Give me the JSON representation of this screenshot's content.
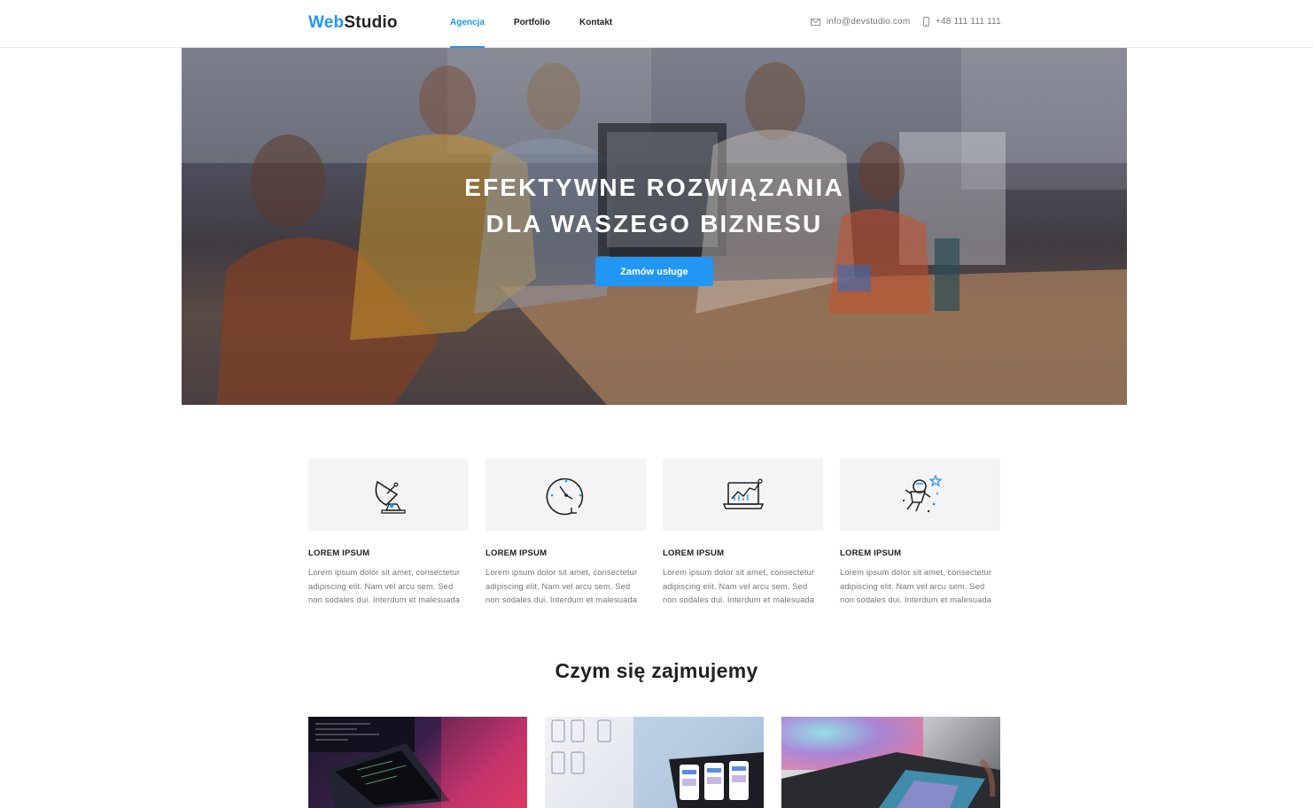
{
  "header": {
    "logo_web": "Web",
    "logo_studio": "Studio",
    "nav": [
      {
        "label": "Agencja",
        "active": true
      },
      {
        "label": "Portfolio",
        "active": false
      },
      {
        "label": "Kontakt",
        "active": false
      }
    ],
    "email": "info@devstudio.com",
    "phone": "+48 111 111 111",
    "email_icon": "envelope-icon",
    "phone_icon": "mobile-phone-icon"
  },
  "hero": {
    "title_line1": "EFEKTYWNE ROZWIĄZANIA",
    "title_line2": "DLA WASZEGO BIZNESU",
    "button_label": "Zamów usługe"
  },
  "features": [
    {
      "icon": "satellite-dish-icon",
      "title": "LOREM IPSUM",
      "line1": "Lorem ipsum dolor sit amet, consectetur",
      "line2": "adipiscing elit. Nam vel arcu sem. Sed",
      "line3": "non sodales dui. Interdum et malesuada"
    },
    {
      "icon": "clock-icon",
      "title": "LOREM IPSUM",
      "line1": "Lorem ipsum dolor sit amet, consectetur",
      "line2": "adipiscing elit. Nam vel arcu sem. Sed",
      "line3": "non sodales dui. Interdum et malesuada"
    },
    {
      "icon": "laptop-chart-icon",
      "title": "LOREM IPSUM",
      "line1": "Lorem ipsum dolor sit amet, consectetur",
      "line2": "adipiscing elit. Nam vel arcu sem. Sed",
      "line3": "non sodales dui. Interdum et malesuada"
    },
    {
      "icon": "astronaut-icon",
      "title": "LOREM IPSUM",
      "line1": "Lorem ipsum dolor sit amet, consectetur",
      "line2": "adipiscing elit. Nam vel arcu sem. Sed",
      "line3": "non sodales dui. Interdum et malesuada"
    }
  ],
  "section": {
    "title": "Czym się zajmujemy"
  },
  "colors": {
    "accent": "#2196f3",
    "text": "#212121",
    "muted": "#757575",
    "icon_box": "#f4f4f7"
  }
}
